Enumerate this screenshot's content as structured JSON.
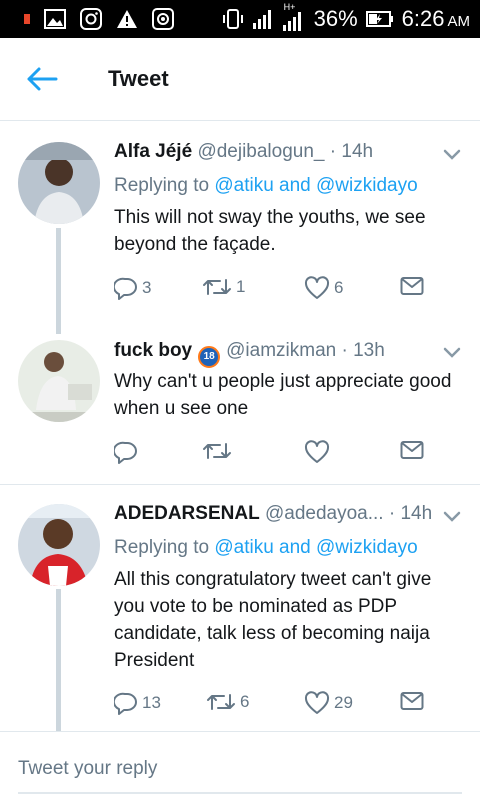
{
  "status_bar": {
    "battery": "36%",
    "time": "6:26",
    "ampm": "AM",
    "network": "H+"
  },
  "header": {
    "title": "Tweet"
  },
  "tweets": [
    {
      "name": "Alfa Jéjé",
      "handle": "@dejibalogun_",
      "time": "· 14h",
      "replying_prefix": "Replying to ",
      "replying_targets": "@atiku and @wizkidayo",
      "text": "This will not sway the youths, we see beyond the façade.",
      "replies": "3",
      "retweets": "1",
      "likes": "6"
    },
    {
      "name": "fuck boy",
      "badge": "18",
      "handle": "@iamzikman",
      "time": "· 13h",
      "text": "Why can't u people just appreciate good when u see one",
      "replies": "",
      "retweets": "",
      "likes": ""
    },
    {
      "name": "ADEDARSENAL",
      "handle": "@adedayoa...",
      "time": "· 14h",
      "replying_prefix": "Replying to ",
      "replying_targets": "@atiku and @wizkidayo",
      "text": "All this congratulatory tweet can't give you vote to be nominated as PDP candidate, talk less of becoming naija President",
      "replies": "13",
      "retweets": "6",
      "likes": "29"
    }
  ],
  "reply": {
    "placeholder": "Tweet your reply"
  },
  "colors": {
    "accent": "#1da1f2",
    "muted": "#657786",
    "divider": "#e1e8ed"
  }
}
